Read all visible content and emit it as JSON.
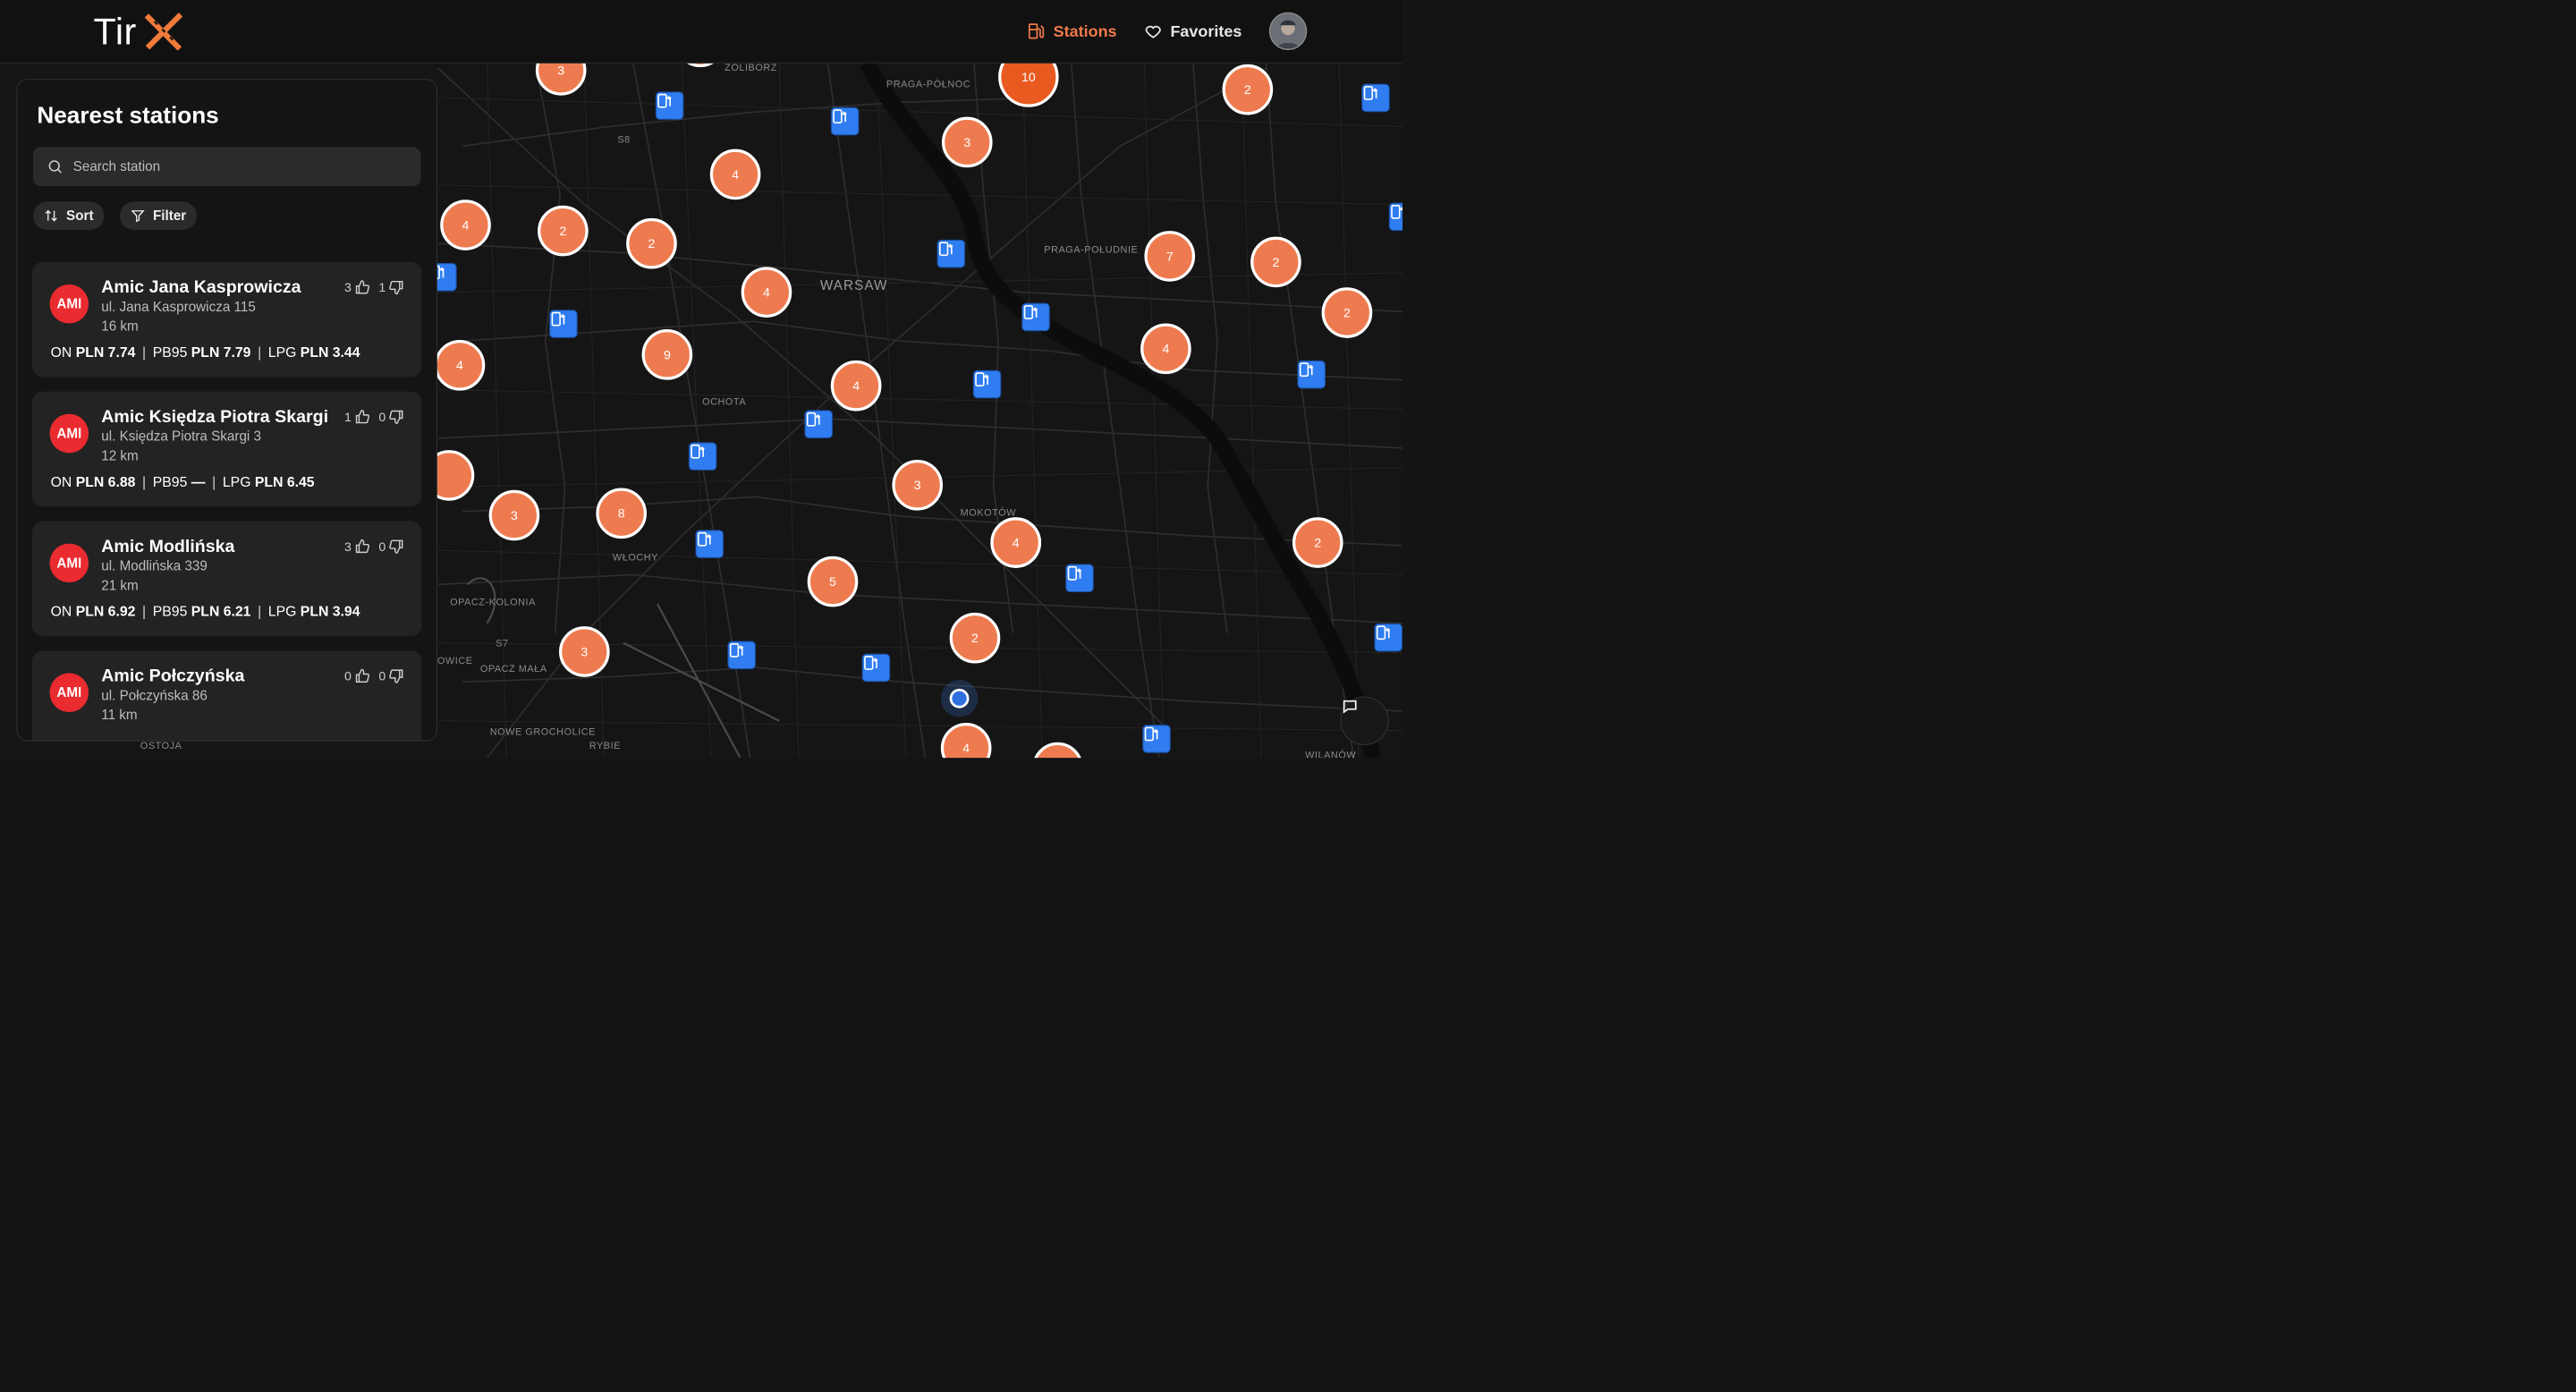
{
  "app": {
    "logo_text": "Tir"
  },
  "nav": {
    "stations_label": "Stations",
    "favorites_label": "Favorites"
  },
  "panel": {
    "title": "Nearest stations",
    "search_placeholder": "Search station",
    "sort_label": "Sort",
    "filter_label": "Filter",
    "stations": [
      {
        "badge": "AMI",
        "name": "Amic Jana Kasprowicza",
        "address": "ul. Jana Kasprowicza 115",
        "distance": "16 km",
        "likes": "3",
        "dislikes": "1",
        "prices": [
          {
            "fuel": "ON",
            "value": "PLN 7.74"
          },
          {
            "fuel": "PB95",
            "value": "PLN 7.79"
          },
          {
            "fuel": "LPG",
            "value": "PLN 3.44"
          }
        ]
      },
      {
        "badge": "AMI",
        "name": "Amic Księdza Piotra Skargi",
        "address": "ul. Księdza Piotra Skargi 3",
        "distance": "12 km",
        "likes": "1",
        "dislikes": "0",
        "prices": [
          {
            "fuel": "ON",
            "value": "PLN 6.88"
          },
          {
            "fuel": "PB95",
            "value": "—"
          },
          {
            "fuel": "LPG",
            "value": "PLN 6.45"
          }
        ]
      },
      {
        "badge": "AMI",
        "name": "Amic Modlińska",
        "address": "ul. Modlińska 339",
        "distance": "21 km",
        "likes": "3",
        "dislikes": "0",
        "prices": [
          {
            "fuel": "ON",
            "value": "PLN 6.92"
          },
          {
            "fuel": "PB95",
            "value": "PLN 6.21"
          },
          {
            "fuel": "LPG",
            "value": "PLN 3.94"
          }
        ]
      },
      {
        "badge": "AMI",
        "name": "Amic Połczyńska",
        "address": "ul. Połczyńska 86",
        "distance": "11 km",
        "likes": "0",
        "dislikes": "0",
        "prices": []
      }
    ]
  },
  "map": {
    "labels": [
      "ŻOLIBORZ",
      "PRAGA-PÓŁNOC",
      "S8",
      "PRAGA-POŁUDNIE",
      "WARSAW",
      "OCHOTA",
      "MOKOTÓW",
      "WŁOCHY",
      "OPACZ-KOLONIA",
      "OPACZ MAŁA",
      "OWICE",
      "NOWE GROCHOLICE",
      "RYBIE",
      "OSTOJA",
      "S7",
      "WILANÓW"
    ],
    "clusters": [
      "3",
      "10",
      "2",
      "3",
      "4",
      "4",
      "2",
      "2",
      "4",
      "7",
      "2",
      "2",
      "4",
      "4",
      "9",
      "4",
      "4",
      "3",
      "3",
      "8",
      "4",
      "2",
      "5",
      "2",
      "3",
      "4"
    ]
  },
  "colors": {
    "accent": "#ee7b50",
    "cluster_large": "#e85a20",
    "station_marker": "#2f7df0",
    "brand_badge": "#ea2b2f",
    "background": "#141414"
  }
}
